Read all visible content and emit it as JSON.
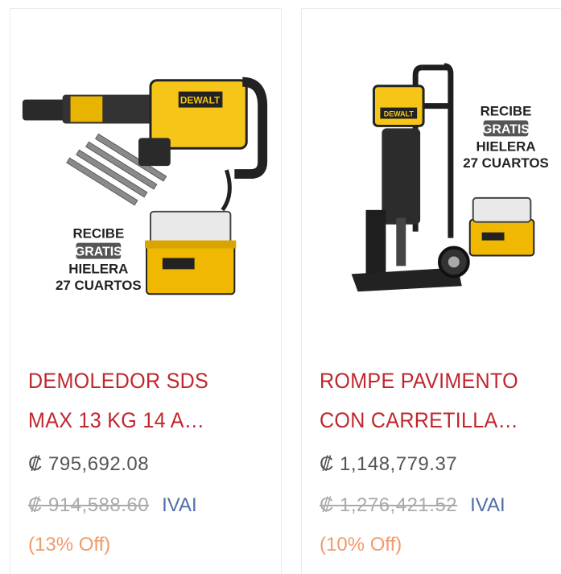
{
  "products": [
    {
      "title_line1": "DEMOLEDOR SDS",
      "title_line2": "MAX 13 KG 14 A…",
      "price": "₡ 795,692.08",
      "old_price": "₡ 914,588.60",
      "tax_label": "IVAI",
      "discount": "(13% Off)",
      "promo": {
        "l1": "RECIBE",
        "l2": "GRATIS",
        "l3": "HIELERA",
        "l4": "27 CUARTOS"
      },
      "brand": "DEWALT"
    },
    {
      "title_line1": "ROMPE PAVIMENTO",
      "title_line2": "CON CARRETILLA…",
      "price": "₡ 1,148,779.37",
      "old_price": "₡ 1,276,421.52",
      "tax_label": "IVAI",
      "discount": "(10% Off)",
      "promo": {
        "l1": "RECIBE",
        "l2": "GRATIS",
        "l3": "HIELERA",
        "l4": "27 CUARTOS"
      },
      "brand": "DEWALT"
    }
  ],
  "colors": {
    "title": "#c0262d",
    "brand_yellow": "#f5c518",
    "discount": "#f19a6a",
    "tax": "#4f6ea6"
  }
}
